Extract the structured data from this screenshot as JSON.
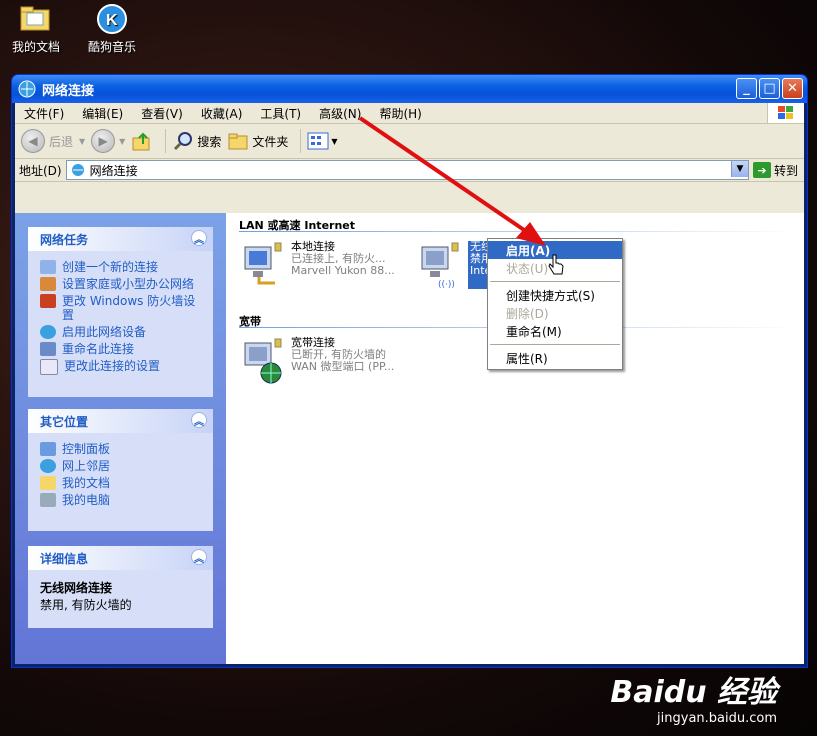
{
  "desktop": {
    "icons": [
      {
        "label": "我的文档"
      },
      {
        "label": "酷狗音乐"
      }
    ]
  },
  "window": {
    "title": "网络连接",
    "buttons": {
      "min": "_",
      "max": "□",
      "close": "✕"
    }
  },
  "menubar": [
    "文件(F)",
    "编辑(E)",
    "查看(V)",
    "收藏(A)",
    "工具(T)",
    "高级(N)",
    "帮助(H)"
  ],
  "toolbar": {
    "back": "后退",
    "search": "搜索",
    "folders": "文件夹"
  },
  "address": {
    "label": "地址(D)",
    "value": "网络连接",
    "go": "转到"
  },
  "tasks_panel": {
    "title": "网络任务",
    "items": [
      "创建一个新的连接",
      "设置家庭或小型办公网络",
      "更改 Windows 防火墙设置",
      "启用此网络设备",
      "重命名此连接",
      "更改此连接的设置"
    ]
  },
  "places_panel": {
    "title": "其它位置",
    "items": [
      "控制面板",
      "网上邻居",
      "我的文档",
      "我的电脑"
    ]
  },
  "details_panel": {
    "title": "详细信息",
    "name": "无线网络连接",
    "status": "禁用, 有防火墙的"
  },
  "groups": {
    "lan": "LAN 或高速 Internet",
    "broadband": "宽带"
  },
  "connections": [
    {
      "name": "本地连接",
      "status": "已连接上, 有防火...",
      "device": "Marvell Yukon 88..."
    },
    {
      "name": "无线网络连接",
      "status": "禁用",
      "device": "Intel"
    },
    {
      "name": "宽带连接",
      "status": "已断开, 有防火墙的",
      "device": "WAN 微型端口 (PP..."
    }
  ],
  "context_menu": [
    {
      "label": "启用(A)",
      "state": "highlighted"
    },
    {
      "label": "状态(U)",
      "state": "disabled"
    },
    {
      "label": "创建快捷方式(S)",
      "state": "normal"
    },
    {
      "label": "删除(D)",
      "state": "disabled"
    },
    {
      "label": "重命名(M)",
      "state": "normal"
    },
    {
      "label": "属性(R)",
      "state": "normal"
    }
  ],
  "watermark": {
    "brand": "Baidu 经验",
    "url": "jingyan.baidu.com"
  },
  "colors": {
    "title_blue": "#0653d8",
    "link_blue": "#215dc6",
    "highlight": "#316ac5",
    "annotation_arrow": "#e01010"
  }
}
